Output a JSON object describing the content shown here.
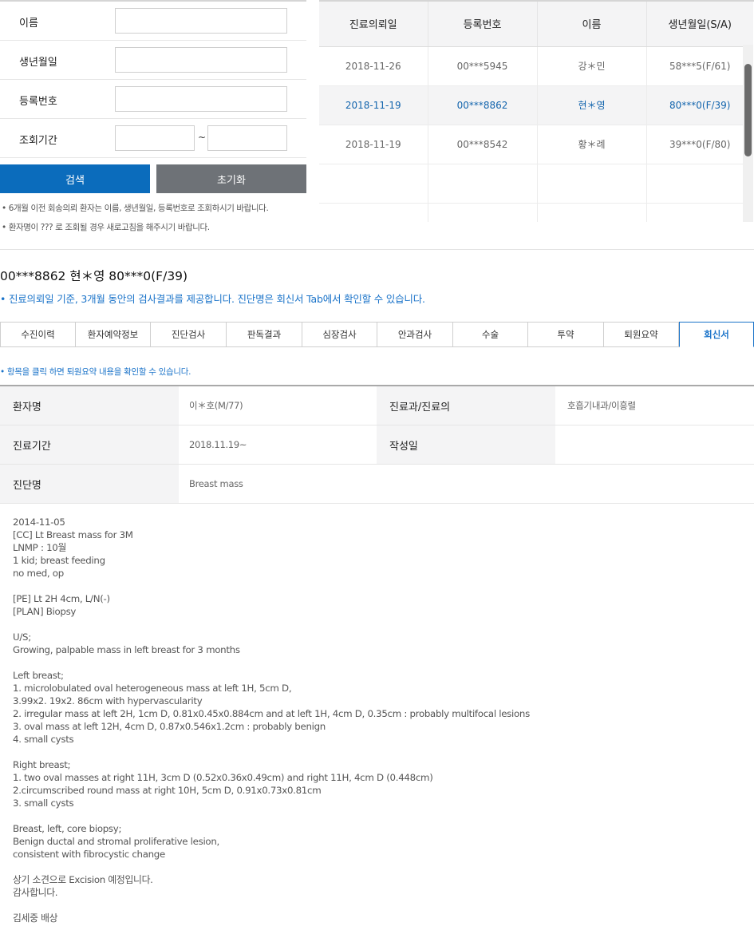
{
  "search": {
    "name_label": "이름",
    "birth_label": "생년월일",
    "reg_label": "등록번호",
    "period_label": "조회기간",
    "tilde": "~",
    "search_button": "검색",
    "reset_button": "초기화",
    "note1": "• 6개월 이전 회송의뢰 환자는 이름, 생년월일, 등록번호로 조회하시기 바랍니다.",
    "note2": "• 환자명이 ??? 로 조회될 경우 새로고침을 해주시기 바랍니다."
  },
  "results": {
    "headers": [
      "진료의뢰일",
      "등록번호",
      "이름",
      "생년월일(S/A)"
    ],
    "rows": [
      [
        "2018-11-26",
        "00***5945",
        "강＊민",
        "58***5(F/61)"
      ],
      [
        "2018-11-19",
        "00***8862",
        "현＊영",
        "80***0(F/39)"
      ],
      [
        "2018-11-19",
        "00***8542",
        "황＊례",
        "39***0(F/80)"
      ]
    ]
  },
  "patient": {
    "line": "00***8862 현＊영 80***0(F/39)",
    "info": "• 진료의뢰일 기준, 3개월 동안의 검사결과를 제공합니다. 진단명은 회신서 Tab에서 확인할 수 있습니다."
  },
  "tabs": [
    "수진이력",
    "환자예약정보",
    "진단검사",
    "판독결과",
    "심장검사",
    "안과검사",
    "수술",
    "투약",
    "퇴원요약",
    "회신서"
  ],
  "click_note": "• 항목을 클릭 하면 퇴원요약 내용을 확인할 수 있습니다.",
  "summary": {
    "patient_name_label": "환자명",
    "patient_name": "이＊호(M/77)",
    "dept_label": "진료과/진료의",
    "dept": "호흡기내과/이흥렬",
    "period_label": "진료기간",
    "period": "2018.11.19~",
    "written_label": "작성일",
    "written": "",
    "diagnosis_label": "진단명",
    "diagnosis": "Breast mass"
  },
  "letter_lines": [
    "2014-11-05",
    "[CC] Lt Breast mass for 3M",
    "LNMP : 10월",
    "1 kid; breast feeding",
    "no med, op",
    "",
    "[PE] Lt 2H 4cm, L/N(-)",
    "[PLAN] Biopsy",
    "",
    "U/S;",
    "Growing, palpable mass in left breast for 3 months",
    "",
    "Left breast;",
    "1. microlobulated oval heterogeneous mass at left 1H, 5cm D,",
    "3.99x2. 19x2. 86cm with hypervascularity",
    "2. irregular mass at left 2H, 1cm D, 0.81x0.45x0.884cm and at left 1H, 4cm D, 0.35cm : probably multifocal lesions",
    "3. oval mass at left 12H, 4cm D, 0.87x0.546x1.2cm : probably benign",
    "4. small cysts",
    "",
    "Right breast;",
    "1. two oval masses at right 11H, 3cm D (0.52x0.36x0.49cm) and right 11H, 4cm D (0.448cm)",
    "2.circumscribed round mass at right 10H, 5cm D, 0.91x0.73x0.81cm",
    "3. small cysts",
    "",
    "Breast, left, core biopsy;",
    "Benign ductal and stromal proliferative lesion,",
    "consistent with fibrocystic change",
    "",
    "상기 소견으로 Excision 예정입니다.",
    "감사합니다.",
    "",
    "김세중 배상"
  ],
  "colors": {
    "accent": "#0b6cbc",
    "reset_button": "#6e7277",
    "info_text": "#1a73c9",
    "selected_row_text": "#1264ad"
  }
}
